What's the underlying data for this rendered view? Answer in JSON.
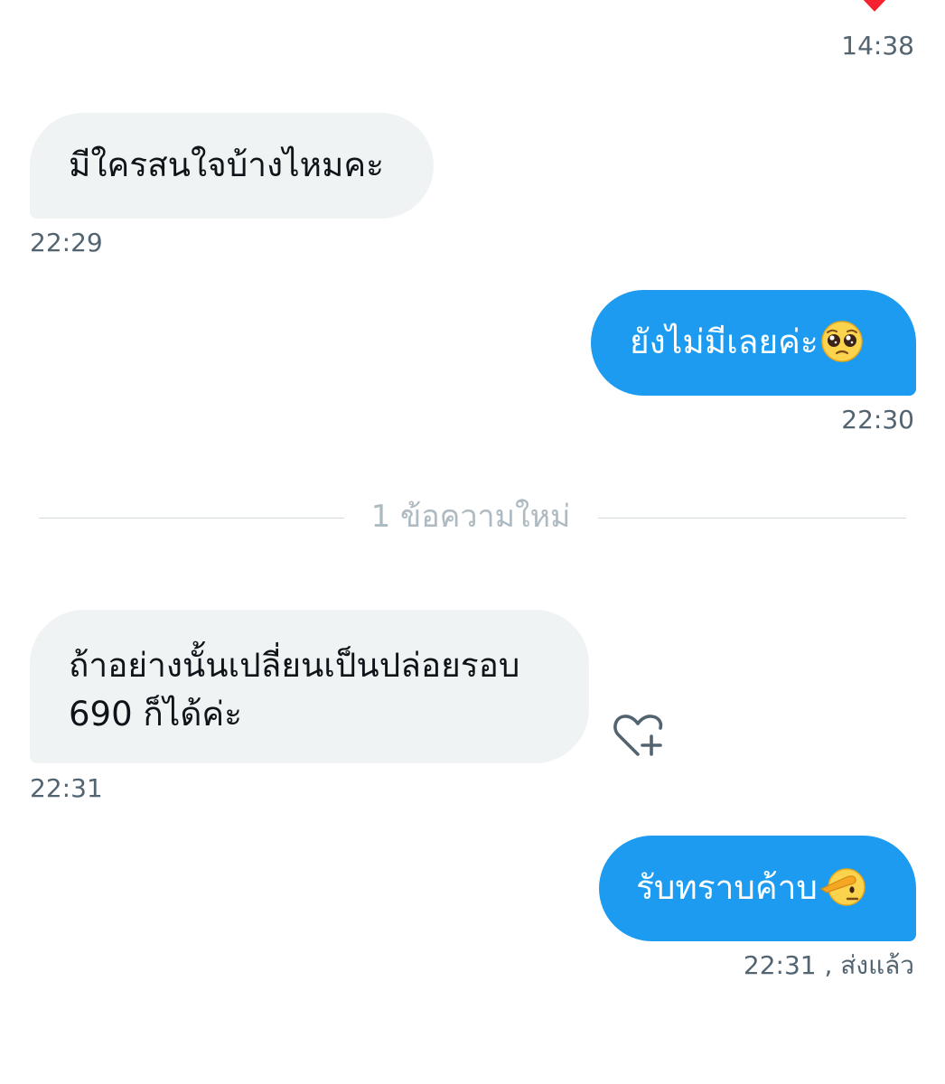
{
  "messages": [
    {
      "text": "มีใครสนใจบ้างไหมคะ",
      "time": "22:29"
    },
    {
      "text": "ยังไม่มีเลยค่ะ",
      "emoji": "pleading-face-emoji",
      "time": "22:30"
    },
    {
      "text_line1": "ถ้าอย่างนั้นเปลี่ยนเป็นปล่อยรอบ",
      "text_line2": "690 ก็ได้ค่ะ",
      "time": "22:31"
    },
    {
      "text": "รับทราบค้าบ",
      "emoji": "saluting-face-emoji",
      "time": "22:31",
      "status": ", ส่งแล้ว"
    }
  ],
  "previous_time": "14:38",
  "new_messages_divider": "1 ข้อความใหม่",
  "colors": {
    "incoming_bubble": "#eff3f4",
    "outgoing_bubble": "#1d9bf0",
    "timestamp": "#536471",
    "divider_text": "#aebac2",
    "reaction_heart": "#f4212e"
  },
  "icons": {
    "reaction": "heart-icon",
    "add_reaction": "add-reaction-heart-icon"
  }
}
